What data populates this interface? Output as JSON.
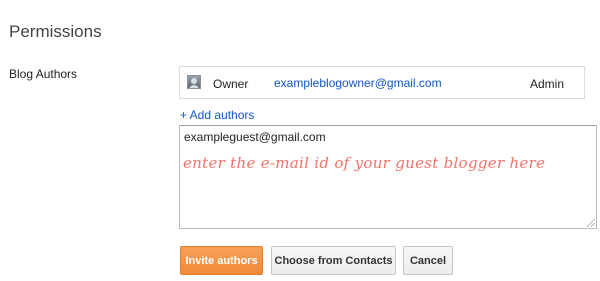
{
  "page": {
    "section_title": "Permissions"
  },
  "blog_authors": {
    "label": "Blog Authors",
    "authors": [
      {
        "role": "Owner",
        "email": "exampleblogowner@gmail.com",
        "access_level": "Admin"
      }
    ],
    "add_authors_link": "+ Add authors"
  },
  "invite": {
    "value": "exampleguest@gmail.com",
    "annotation": "enter the e-mail id of your guest blogger here"
  },
  "buttons": {
    "invite": "Invite authors",
    "contacts": "Choose from Contacts",
    "cancel": "Cancel"
  },
  "colors": {
    "link": "#1155cc",
    "primary_button": "#f08a36",
    "annotation": "#f2736b"
  }
}
